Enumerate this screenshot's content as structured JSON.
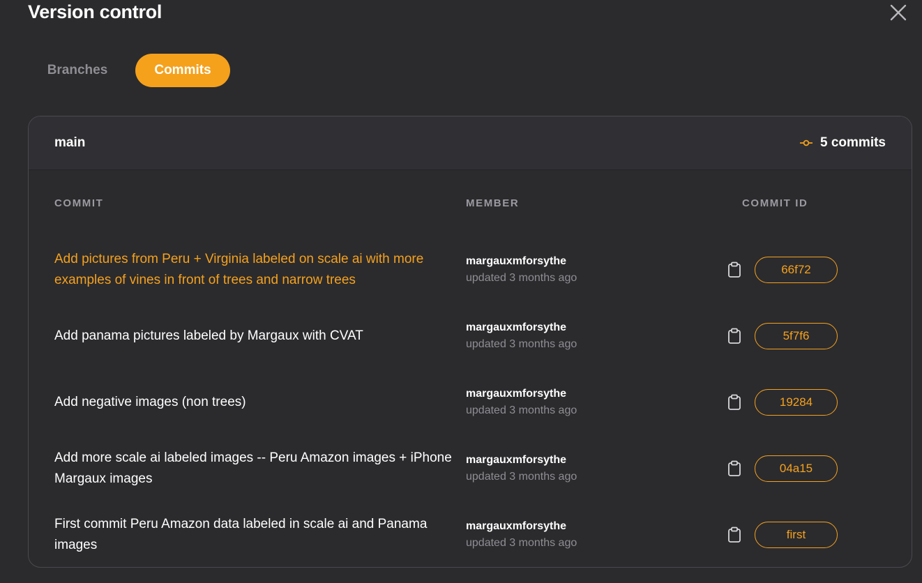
{
  "header": {
    "title": "Version control"
  },
  "tabs": [
    {
      "label": "Branches",
      "active": false
    },
    {
      "label": "Commits",
      "active": true
    }
  ],
  "branch": {
    "name": "main",
    "commit_count": "5 commits"
  },
  "columns": {
    "commit": "COMMIT",
    "member": "MEMBER",
    "commit_id": "COMMIT ID"
  },
  "commits": [
    {
      "message": "Add pictures from Peru + Virginia labeled on scale ai with more examples of vines in front of trees and narrow trees",
      "member": "margauxmforsythe",
      "updated": "updated 3 months ago",
      "id": "66f72",
      "highlighted": true
    },
    {
      "message": "Add panama pictures labeled by Margaux with CVAT",
      "member": "margauxmforsythe",
      "updated": "updated 3 months ago",
      "id": "5f7f6",
      "highlighted": false
    },
    {
      "message": "Add negative images (non trees)",
      "member": "margauxmforsythe",
      "updated": "updated 3 months ago",
      "id": "19284",
      "highlighted": false
    },
    {
      "message": "Add more scale ai labeled images -- Peru Amazon images + iPhone Margaux images",
      "member": "margauxmforsythe",
      "updated": "updated 3 months ago",
      "id": "04a15",
      "highlighted": false
    },
    {
      "message": "First commit Peru Amazon data labeled in scale ai and Panama images",
      "member": "margauxmforsythe",
      "updated": "updated 3 months ago",
      "id": "first",
      "highlighted": false
    }
  ],
  "colors": {
    "accent": "#f5a11c",
    "background": "#2b2b2e",
    "muted": "#8e8e93"
  },
  "icons": {
    "close": "close-icon",
    "commit": "git-commit-icon",
    "copy": "clipboard-icon"
  }
}
